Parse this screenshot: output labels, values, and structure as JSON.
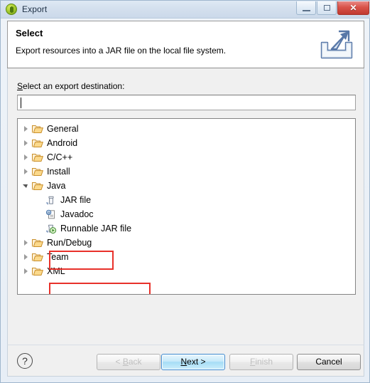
{
  "window": {
    "title": "Export",
    "title_icon": "eclipse-ball-icon",
    "controls": {
      "minimize": "minimize-icon",
      "maximize": "maximize-icon",
      "close": "✕"
    }
  },
  "header": {
    "title": "Select",
    "description": "Export resources into a JAR file on the local file system.",
    "icon": "export-wizard-icon"
  },
  "main": {
    "destination_label_mnemonic": "S",
    "destination_label_rest": "elect an export destination:",
    "destination_value": "",
    "destination_placeholder": "",
    "tree": [
      {
        "label": "General",
        "icon": "folder-icon",
        "state": "collapsed",
        "level": 0
      },
      {
        "label": "Android",
        "icon": "folder-icon",
        "state": "collapsed",
        "level": 0
      },
      {
        "label": "C/C++",
        "icon": "folder-icon",
        "state": "collapsed",
        "level": 0
      },
      {
        "label": "Install",
        "icon": "folder-icon",
        "state": "collapsed",
        "level": 0
      },
      {
        "label": "Java",
        "icon": "folder-icon",
        "state": "expanded",
        "level": 0
      },
      {
        "label": "JAR file",
        "icon": "jar-file-icon",
        "state": "leaf",
        "level": 1
      },
      {
        "label": "Javadoc",
        "icon": "javadoc-icon",
        "state": "leaf",
        "level": 1
      },
      {
        "label": "Runnable JAR file",
        "icon": "runnable-jar-file-icon",
        "state": "leaf",
        "level": 1
      },
      {
        "label": "Run/Debug",
        "icon": "folder-icon",
        "state": "collapsed",
        "level": 0
      },
      {
        "label": "Team",
        "icon": "folder-icon",
        "state": "collapsed",
        "level": 0
      },
      {
        "label": "XML",
        "icon": "folder-icon",
        "state": "collapsed",
        "level": 0
      }
    ],
    "annotations": [
      {
        "target": "JAR file",
        "color": "#e8312a"
      },
      {
        "target": "Runnable JAR file",
        "color": "#e8312a"
      }
    ]
  },
  "footer": {
    "help_label": "?",
    "back": {
      "prefix": "< ",
      "mnemonic": "B",
      "rest": "ack",
      "enabled": false
    },
    "next": {
      "prefix": "",
      "mnemonic": "N",
      "rest": "ext >",
      "enabled": true,
      "default": true
    },
    "finish": {
      "prefix": "",
      "mnemonic": "F",
      "rest": "inish",
      "enabled": false
    },
    "cancel": {
      "prefix": "",
      "mnemonic": "",
      "rest": "Cancel",
      "enabled": true
    }
  },
  "colors": {
    "annotation": "#e8312a",
    "default_button": "#3c8ad0",
    "close_button": "#c03a30",
    "folder": "#f0b64a"
  }
}
